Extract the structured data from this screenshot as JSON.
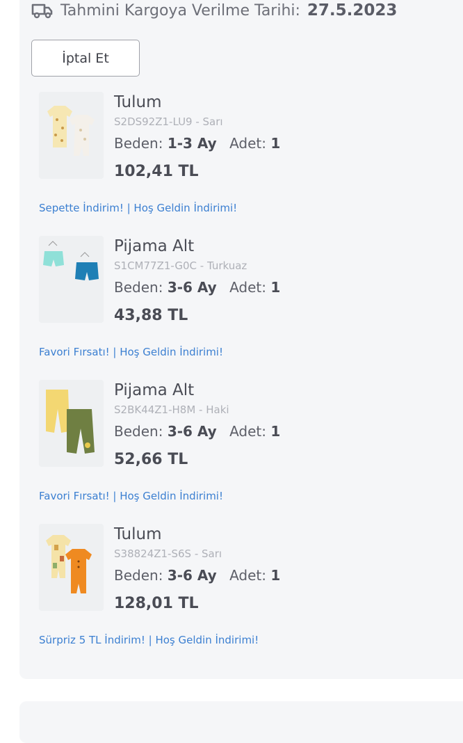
{
  "shipping": {
    "label": "Tahmini Kargoya Verilme Tarihi:",
    "date": "27.5.2023"
  },
  "cancel_button": {
    "label": "İptal Et"
  },
  "items": [
    {
      "name": "Tulum",
      "sku": "S2DS92Z1-LU9 - Sarı",
      "size_label": "Beden:",
      "size": "1-3 Ay",
      "qty_label": "Adet:",
      "qty": "1",
      "price": "102,41 TL",
      "promo": "Sepette İndirim! | Hoş Geldin İndirimi!"
    },
    {
      "name": "Pijama Alt",
      "sku": "S1CM77Z1-G0C - Turkuaz",
      "size_label": "Beden:",
      "size": "3-6 Ay",
      "qty_label": "Adet:",
      "qty": "1",
      "price": "43,88 TL",
      "promo": "Favori Fırsatı! | Hoş Geldin İndirimi!"
    },
    {
      "name": "Pijama Alt",
      "sku": "S2BK44Z1-H8M - Haki",
      "size_label": "Beden:",
      "size": "3-6 Ay",
      "qty_label": "Adet:",
      "qty": "1",
      "price": "52,66 TL",
      "promo": "Favori Fırsatı! | Hoş Geldin İndirimi!"
    },
    {
      "name": "Tulum",
      "sku": "S38824Z1-S6S - Sarı",
      "size_label": "Beden:",
      "size": "3-6 Ay",
      "qty_label": "Adet:",
      "qty": "1",
      "price": "128,01 TL",
      "promo": "Sürpriz 5 TL İndirim! | Hoş Geldin İndirimi!"
    }
  ],
  "colors": {
    "card_bg": "#f5f6f8",
    "promo_link": "#3b7fd1",
    "text_dark": "#4a4c55"
  },
  "icons": {
    "shipping": "truck-icon"
  }
}
